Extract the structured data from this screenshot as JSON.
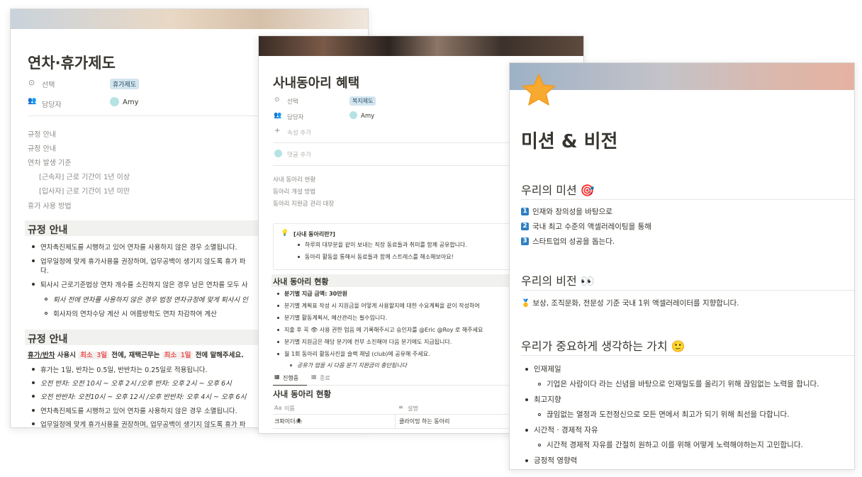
{
  "card1": {
    "title": "연차·휴가제도",
    "props": {
      "select_label": "선택",
      "select_value": "휴가제도",
      "owner_label": "담당자",
      "owner_value": "Amy"
    },
    "toc": [
      "규정 안내",
      "규정 안내",
      "연차 발생 기준",
      "[근속자] 근로 기간이 1년 이상",
      "[입사자] 근로 기간이 1년 미만",
      "휴가 사용 방법"
    ],
    "section1": {
      "heading": "규정 안내",
      "bullets": [
        "연차촉진제도를 시행하고 있어 연차를 사용하지 않은 경우 소멸됩니다.",
        "업무일정에 맞게 휴가사용을 권장하며, 업무공백이 생기지 않도록 휴가 파",
        "다.",
        "퇴사시 근로기준법상 연차 개수를 소진하지 않은 경우 남은 연차를 모두 사"
      ],
      "sub": [
        "퇴사 전에 연차를 사용하지 않은 경우 법정 연차규정에 맞게 퇴사시 인",
        "회사자의 연차수당 계산 시 여름방학도 연차 차감하여 계산"
      ]
    },
    "section2": {
      "heading": "규정 안내",
      "rule_a": "휴가/반차",
      "rule_b": " 사용시 ",
      "chip1": "최소 3일",
      "rule_c": " 전에, 재택근무는 ",
      "chip2": "최소 1일",
      "rule_d": " 전에 말해주세요.",
      "bullets": [
        "휴가는 1일, 반차는 0.5일, 반반차는 0.25일로 적용됩니다.",
        "오전 반차: 오전 10시 ~ 오후 2시 /오후 반차: 오후 2시 ~ 오후 6시",
        "오전 반반차: 오전10시 ~ 오후 12시 /오후 반반차: 오후 4시 ~ 오후 6시",
        "연차촉진제도를 시행하고 있어 연차를 사용하지 않은 경우 소멸됩니다.",
        "업무일정에 맞게 휴가사용을 권장하며, 업무공백이 생기지 않도록 휴가 파"
      ]
    }
  },
  "card2": {
    "title": "사내동아리 혜택",
    "props": {
      "select_label": "선택",
      "select_value": "복지제도",
      "owner_label": "담당자",
      "owner_value": "Amy",
      "add_prop": "속성 추가",
      "add_comment": "댓글 추가"
    },
    "links": [
      "사내 동아리 현황",
      "동아리 개설 방법",
      "동아리 지원금 관리 대장"
    ],
    "callout": {
      "title": "[사내 동아리란?]",
      "lines": [
        "하루의 대부분을 같이 보내는 직장 동료들과 취미를 함께 공유합니다.",
        "동아리 활동을 통해서 동료들과 함께 스트레스를 해소해보아요!"
      ]
    },
    "section": {
      "heading": "사내 동아리 현황",
      "bullets": [
        "분기별 지급 금액: 30만원",
        "분기별 계획표 작성 시 지원금을 어떻게 사용할지에 대한 수요계획을 같이 작성하여",
        "분기별 활동계획서, 예산관리는 필수입니다.",
        "지출 후 꼭 👁 사용 권한 업음 에 기록해주시고 승인자를 @Eric @Roy 로 해주세요",
        "분기별 지원금은 해당 분기에 전부 소진해야 다음 분기에도 지급됩니다.",
        "월 1회 동아리 활동사진을 슬랙 채널 (club)에 공유해 주세요."
      ],
      "sub": "공유가 업을 시 다음 분기 지원금이 중단됩니다"
    },
    "tabs": [
      "진행중",
      "종료"
    ],
    "table": {
      "title": "사내 동아리 현황",
      "col_name": "이름",
      "col_desc": "설명",
      "row_name": "크파이더🕷",
      "row_desc": "클라이밍 하는 동아리"
    }
  },
  "card3": {
    "icon": "star-icon",
    "title": "미션 & 비전",
    "mission_heading": "우리의 미션 🎯",
    "mission": [
      "인재와 창의성을 바탕으로",
      "국내 최고 수준의 액셀러레이팅을 통해",
      "스타트업의 성공을 돕는다."
    ],
    "mission_nums": [
      "1",
      "2",
      "3"
    ],
    "vision_heading": "우리의 비전 👀",
    "vision": "🥇 보상, 조직문화, 전문성 기준 국내 1위 액셀러레이터를 지향합니다.",
    "values_heading": "우리가 중요하게 생각하는 가치 🙂",
    "values": [
      {
        "name": "인재제일",
        "desc": "기업은 사람이다 라는 신념을 바탕으로 인재밀도를 올리기 위해 끊임없는 노력을 합니다."
      },
      {
        "name": "최고지향",
        "desc": "끊임없는 열정과 도전정신으로 모든 면에서 최고가 되기 위해 최선을 다합니다."
      },
      {
        "name": "시간적 · 경제적 자유",
        "desc": "시간적 경제적 자유를 간절히 원하고 이를 위해 어떻게 노력해야하는지 고민합니다."
      },
      {
        "name": "긍정적 영향력",
        "desc": ""
      }
    ]
  }
}
